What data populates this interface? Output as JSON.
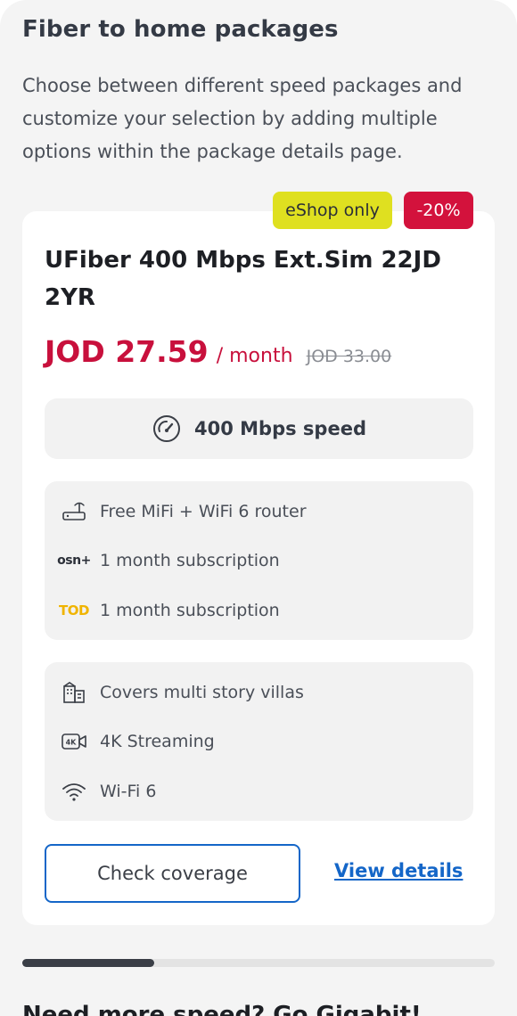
{
  "section": {
    "title": "Fiber to home packages",
    "description": "Choose between different speed packages and customize your selection by adding multiple options within the package details page."
  },
  "card": {
    "badges": {
      "eshop": "eShop only",
      "discount": "-20%"
    },
    "plan_name": "UFiber 400 Mbps Ext.Sim 22JD 2YR",
    "price": "JOD 27.59",
    "per_month": "/ month",
    "old_price": "JOD 33.00",
    "speed": {
      "icon": "speedometer-icon",
      "label": "400 Mbps speed"
    },
    "extras": [
      {
        "icon": "router-icon",
        "label": "Free MiFi + WiFi 6 router"
      },
      {
        "icon": "osn-plus-logo",
        "logo_text": "osn+",
        "label": "1 month subscription"
      },
      {
        "icon": "tod-logo",
        "logo_text": "TOD",
        "label": "1 month subscription"
      }
    ],
    "features": [
      {
        "icon": "building-icon",
        "label": "Covers multi story villas"
      },
      {
        "icon": "4k-camera-icon",
        "label": "4K Streaming"
      },
      {
        "icon": "wifi-icon",
        "label": "Wi-Fi 6"
      }
    ],
    "check_coverage_label": "Check coverage",
    "view_details_label": "View details"
  },
  "carousel": {
    "progress": 0.28
  },
  "next_section": {
    "title": "Need more speed? Go Gigabit!"
  },
  "colors": {
    "price": "#c8103c",
    "eshop_badge": "#dfe020",
    "discount_badge": "#d3123c",
    "link": "#1466c8"
  }
}
